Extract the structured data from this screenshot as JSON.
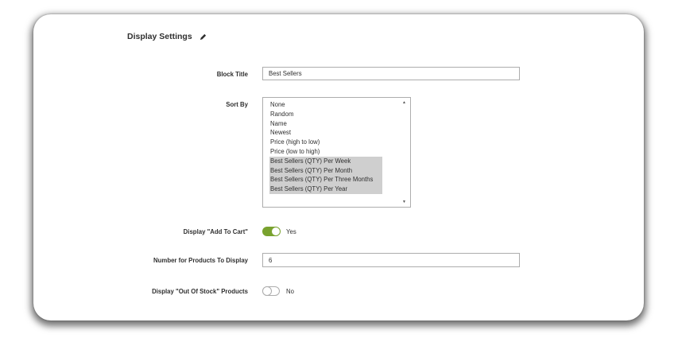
{
  "section": {
    "title": "Display Settings",
    "edit_icon": "pencil-icon"
  },
  "fields": {
    "block_title": {
      "label": "Block Title",
      "value": "Best Sellers"
    },
    "sort_by": {
      "label": "Sort By",
      "options": [
        {
          "label": "None",
          "selected": false
        },
        {
          "label": "Random",
          "selected": false
        },
        {
          "label": "Name",
          "selected": false
        },
        {
          "label": "Newest",
          "selected": false
        },
        {
          "label": "Price (high to low)",
          "selected": false
        },
        {
          "label": "Price (low to high)",
          "selected": false
        },
        {
          "label": "Best Sellers (QTY) Per Week",
          "selected": true
        },
        {
          "label": "Best Sellers (QTY) Per Month",
          "selected": true
        },
        {
          "label": "Best Sellers (QTY) Per Three Months",
          "selected": true
        },
        {
          "label": "Best Sellers (QTY) Per Year",
          "selected": true
        }
      ]
    },
    "add_to_cart": {
      "label": "Display \"Add To Cart\"",
      "state": "Yes",
      "enabled": true
    },
    "products_count": {
      "label": "Number for Products To Display",
      "value": "6"
    },
    "out_of_stock": {
      "label": "Display \"Out Of Stock\" Products",
      "state": "No",
      "enabled": false
    }
  },
  "colors": {
    "toggle_on": "#79a22e",
    "selected_option": "#cfcfcf",
    "border": "#adadad"
  }
}
